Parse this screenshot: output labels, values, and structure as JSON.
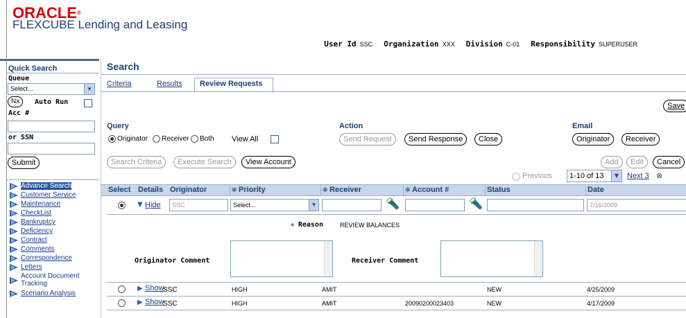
{
  "header": {
    "brand": "ORACLE",
    "product": "FLEXCUBE Lending and Leasing",
    "user_bar": {
      "user_id_label": "User Id",
      "user_id": "SSC",
      "org_label": "Organization",
      "org": "XXX",
      "division_label": "Division",
      "division": "C-01",
      "resp_label": "Responsibility",
      "resp": "SUPERUSER"
    }
  },
  "quick_search": {
    "title": "Quick Search",
    "queue_label": "Queue",
    "queue_value": "Select...",
    "nx_label": "Nx",
    "auto_run_label": "Auto Run",
    "acc_label": "Acc #",
    "ssn_label": "or SSN",
    "submit_label": "Submit"
  },
  "nav": [
    {
      "label": "Advance Search",
      "active": true
    },
    {
      "label": "Customer Service"
    },
    {
      "label": "Maintenance"
    },
    {
      "label": "CheckList"
    },
    {
      "label": "Bankruptcy"
    },
    {
      "label": "Deficiency"
    },
    {
      "label": "Contract"
    },
    {
      "label": "Comments"
    },
    {
      "label": "Correspondence"
    },
    {
      "label": "Letters"
    },
    {
      "label": "Account Document Tracking"
    },
    {
      "label": "Scenario Analysis"
    }
  ],
  "main": {
    "title": "Search",
    "tabs": [
      "Criteria",
      "Results",
      "Review Requests"
    ],
    "save_label": "Save",
    "query": {
      "label": "Query",
      "originator": "Originator",
      "receiver": "Receiver",
      "both": "Both",
      "view_all": "View All"
    },
    "action": {
      "label": "Action",
      "send_request": "Send Request",
      "send_response": "Send Response",
      "close": "Close"
    },
    "email": {
      "label": "Email",
      "originator": "Originator",
      "receiver": "Receiver"
    },
    "toolbar": {
      "search_criteria": "Search Criteria",
      "execute_search": "Execute Search",
      "view_account": "View Account",
      "add": "Add",
      "edit": "Edit",
      "cancel": "Cancel"
    },
    "pagination": {
      "previous": "Previous",
      "range": "1-10 of 13",
      "next": "Next 3"
    },
    "columns": [
      "Select",
      "Details",
      "Originator",
      "Priority",
      "Receiver",
      "Account #",
      "Status",
      "Date"
    ],
    "edit_row": {
      "hide_label": "Hide",
      "originator": "SSC",
      "priority": "Select...",
      "date": "7/16/2009",
      "reason_label": "Reason",
      "reason_value": "REVIEW BALANCES",
      "originator_comment_label": "Originator Comment",
      "receiver_comment_label": "Receiver Comment"
    },
    "rows": [
      {
        "show": "Show",
        "originator": "SSC",
        "priority": "HIGH",
        "receiver": "AMIT",
        "account": "",
        "status": "NEW",
        "date": "4/25/2009"
      },
      {
        "show": "Show",
        "originator": "SSC",
        "priority": "HIGH",
        "receiver": "AMIT",
        "account": "20090200023403",
        "status": "NEW",
        "date": "4/17/2009"
      }
    ]
  },
  "colors": {
    "brand_red": "#d9000d",
    "navy": "#1a3e73",
    "header_blue": "#c8d7eb",
    "link_blue": "#1a3a8e"
  }
}
